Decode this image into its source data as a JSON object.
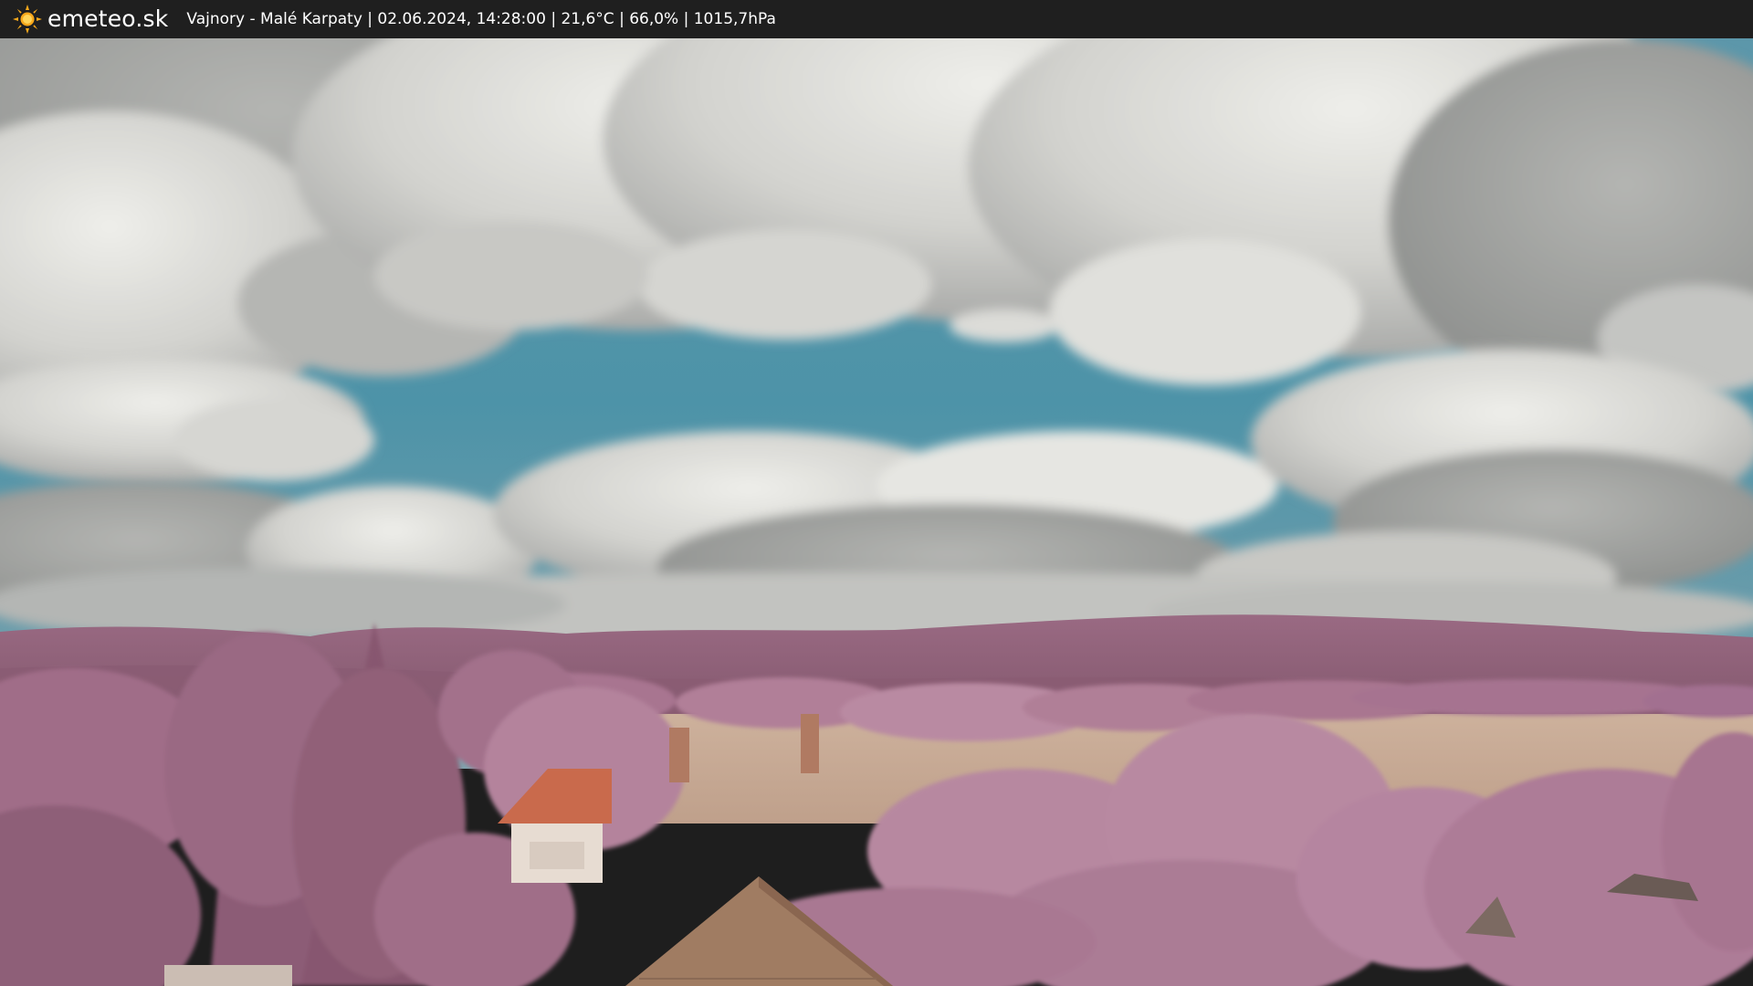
{
  "header": {
    "brand": "emeteo.sk",
    "logo_icon": "sun-icon",
    "caption": "Vajnory - Malé Karpaty | 02.06.2024, 14:28:00 | 21,6°C | 66,0% | 1015,7hPa"
  },
  "colors": {
    "bar_background": "#1f1f1f",
    "sky": "#4f95a7",
    "foliage": "#a9748f",
    "hills": "#8f6279",
    "field": "#c6ab96",
    "roof": "#a07c62",
    "sun": "#f7a81b"
  }
}
